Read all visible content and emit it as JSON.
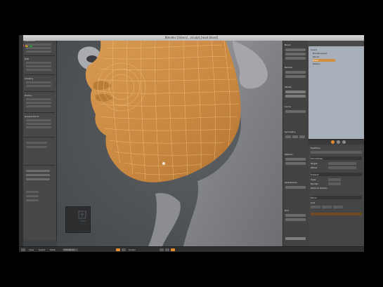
{
  "window": {
    "title": "Blender [/Users/.../sculpt_head.blend]"
  },
  "left_panel": {
    "rows": [
      "Transform",
      "Translate",
      "Rotate",
      "Scale",
      "Edit",
      "Duplicate",
      "Delete",
      "Join",
      "Shading",
      "Smooth",
      "Flat",
      "History",
      "Undo",
      "Redo",
      "Repeat",
      "Grease Pencil",
      "Draw",
      "Line",
      "Erase"
    ]
  },
  "right_tools": {
    "rows": [
      "Brush",
      "Radius",
      "Strength",
      "Autosmooth",
      "Texture",
      "Stroke",
      "Curve",
      "Symmetry",
      "X",
      "Y",
      "Z",
      "Options",
      "Threaded",
      "Fast Nav",
      "Appearance",
      "Tool"
    ]
  },
  "outliner": {
    "items": [
      "Scene",
      "RenderLayers",
      "World",
      "Head",
      "Retopo"
    ]
  },
  "properties": {
    "rows": [
      "Modifiers",
      "Add Modifier",
      "Shrinkwrap",
      "Target:",
      "Offset:",
      "Subsurf",
      "View:",
      "Render:",
      "Optimal Display",
      "Apply",
      "Copy",
      "Mirror",
      "Axis",
      "X",
      "Y",
      "Z"
    ]
  },
  "bottombar": {
    "items": [
      "View",
      "Select",
      "Mesh",
      "Edit Mode",
      "Global"
    ]
  },
  "colors": {
    "mesh": "#d99a4a",
    "mesh_wire": "#f0c276",
    "sculpt": "#8f9195",
    "background": "#55585b"
  }
}
